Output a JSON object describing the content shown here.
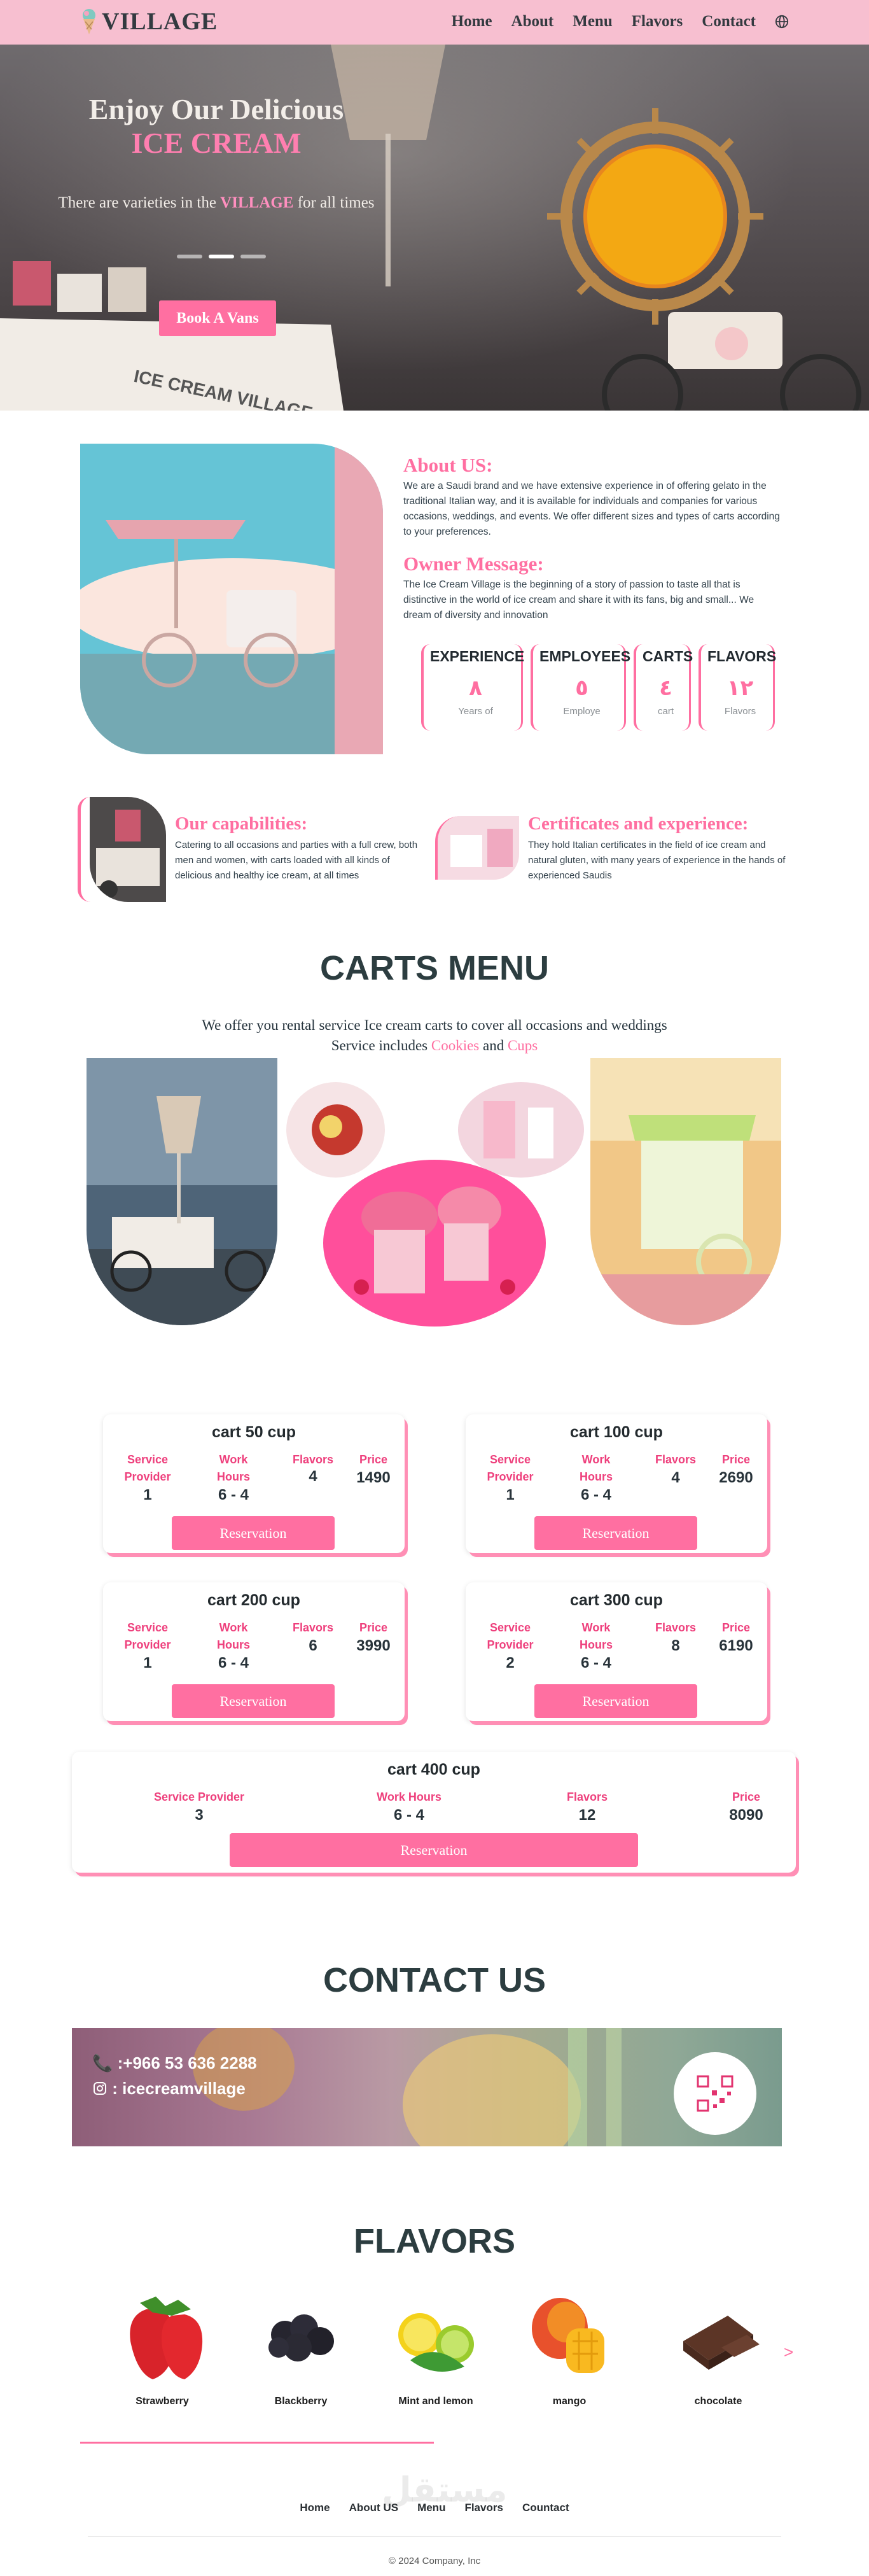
{
  "nav": {
    "brand": "VILLAGE",
    "links": [
      "Home",
      "About",
      "Menu",
      "Flavors",
      "Contact"
    ]
  },
  "hero": {
    "title": "Enjoy Our Delicious",
    "subtitle": "ICE CREAM",
    "desc_pre": "There are varieties in the",
    "desc_brand": "VILLAGE",
    "desc_post": "for all times",
    "button": "Book A Vans",
    "cart_sign": "ICE CREAM VILLAGE"
  },
  "about": {
    "about_title": "About US:",
    "about_text": "We are a Saudi brand and we have extensive experience in of offering gelato in the traditional Italian way, and it is available for individuals and companies for various occasions, weddings, and events. We offer different sizes and types of carts according to your preferences.",
    "owner_title": "Owner Message:",
    "owner_text": "The Ice Cream Village is the beginning of a story of passion to taste all that is distinctive in the world of ice cream and share it with its fans, big and small... We dream of diversity and innovation",
    "stats": [
      {
        "title": "EXPERIENCE",
        "value": "٨",
        "unit": "Years of"
      },
      {
        "title": "EMPLOYEES",
        "value": "٥",
        "unit": "Employe"
      },
      {
        "title": "CARTS",
        "value": "٤",
        "unit": "cart"
      },
      {
        "title": "FLAVORS",
        "value": "١٢",
        "unit": "Flavors"
      }
    ]
  },
  "capabilities": {
    "title": "Our capabilities:",
    "text": "Catering to all occasions and parties with a full crew, both men and women, with carts loaded with all kinds of delicious and healthy ice cream, at all times"
  },
  "certificates": {
    "title": "Certificates and experience:",
    "text": "They hold Italian certificates in the field of ice cream and natural gluten, with many years of experience in the hands of experienced Saudis"
  },
  "carts_menu": {
    "title": "CARTS MENU",
    "line1": "We offer you rental service Ice cream carts to cover all occasions and weddings",
    "line2_pre": "Service includes",
    "cookies": "Cookies",
    "and": "and",
    "cups": "Cups"
  },
  "pricing": {
    "col_headers": {
      "provider": "Service Provider",
      "hours": "Work Hours",
      "flavors": "Flavors",
      "price": "Price"
    },
    "button": "Reservation",
    "cards": [
      {
        "title": "cart 50 cup",
        "provider": "1",
        "hours": "6 - 4",
        "flavors": "4",
        "price": "1490"
      },
      {
        "title": "cart 100 cup",
        "provider": "1",
        "hours": "6 - 4",
        "flavors": "4",
        "price": "2690"
      },
      {
        "title": "cart 200 cup",
        "provider": "1",
        "hours": "6 - 4",
        "flavors": "6",
        "price": "3990"
      },
      {
        "title": "cart 300 cup",
        "provider": "2",
        "hours": "6 - 4",
        "flavors": "8",
        "price": "6190"
      },
      {
        "title": "cart 400 cup",
        "provider": "3",
        "hours": "6 - 4",
        "flavors": "12",
        "price": "8090"
      }
    ]
  },
  "contact": {
    "title": "CONTACT US",
    "phone": ":+966 53 636 2288",
    "instagram": ": icecreamvillage"
  },
  "flavors": {
    "title": "FLAVORS",
    "items": [
      "Strawberry",
      "Blackberry",
      "Mint and lemon",
      "mango",
      "chocolate"
    ],
    "next": ">"
  },
  "footer": {
    "links": [
      "Home",
      "About US",
      "Menu",
      "Flavors",
      "Countact"
    ],
    "copyright": "© 2024 Company, Inc",
    "watermark": "مستقل"
  },
  "colors": {
    "accent": "#ff6fa1",
    "nav_bg": "#f7bfd0",
    "dark": "#2c3d40"
  }
}
